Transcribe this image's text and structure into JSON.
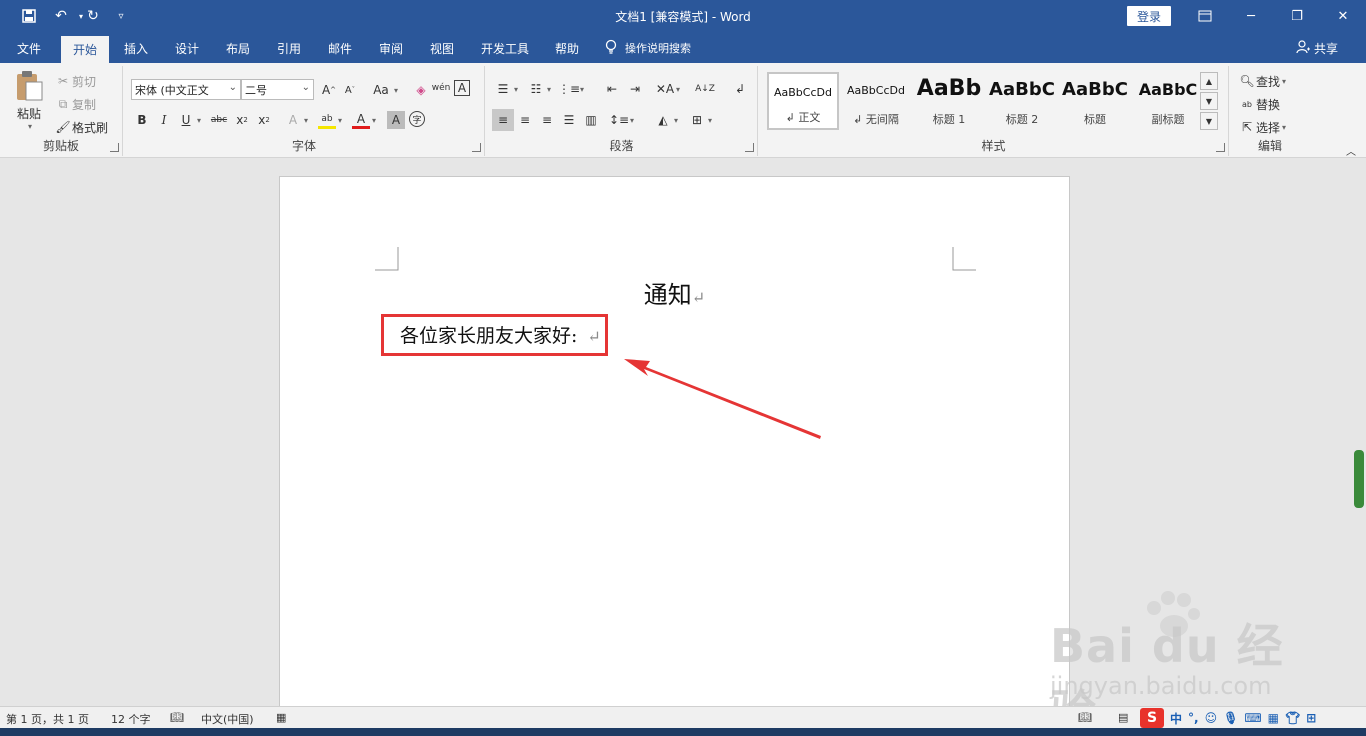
{
  "window": {
    "title": "文档1 [兼容模式] - Word",
    "login": "登录"
  },
  "tabs": [
    {
      "label": "文件"
    },
    {
      "label": "开始",
      "active": true
    },
    {
      "label": "插入"
    },
    {
      "label": "设计"
    },
    {
      "label": "布局"
    },
    {
      "label": "引用"
    },
    {
      "label": "邮件"
    },
    {
      "label": "审阅"
    },
    {
      "label": "视图"
    },
    {
      "label": "开发工具"
    },
    {
      "label": "帮助"
    }
  ],
  "tell_me": "操作说明搜索",
  "share": "共享",
  "ribbon": {
    "clipboard": {
      "label": "剪贴板",
      "paste": "粘贴",
      "cut": "剪切",
      "copy": "复制",
      "format_painter": "格式刷"
    },
    "font": {
      "label": "字体",
      "font_name": "宋体 (中文正文",
      "font_size": "二号"
    },
    "paragraph": {
      "label": "段落"
    },
    "styles": {
      "label": "样式",
      "items": [
        {
          "sample": "AaBbCcDd",
          "name": "↲ 正文"
        },
        {
          "sample": "AaBbCcDd",
          "name": "↲ 无间隔"
        },
        {
          "sample": "AaBb",
          "name": "标题 1"
        },
        {
          "sample": "AaBbC",
          "name": "标题 2"
        },
        {
          "sample": "AaBbC",
          "name": "标题"
        },
        {
          "sample": "AaBbC",
          "name": "副标题"
        }
      ]
    },
    "editing": {
      "label": "编辑",
      "find": "查找",
      "replace": "替换",
      "select": "选择"
    }
  },
  "document": {
    "heading": "通知",
    "greeting": "各位家长朋友大家好:",
    "paragraph_mark": "↵"
  },
  "status": {
    "page": "第 1 页，共 1 页",
    "words": "12 个字",
    "language": "中文(中国)"
  },
  "ime": {
    "mode": "中"
  },
  "watermark": {
    "brand": "Bai du 经验",
    "url": "jingyan.baidu.com"
  },
  "colors": {
    "word_blue": "#2b579a",
    "highlight_red": "#e53535",
    "ribbon_bg": "#f3f3f3"
  }
}
